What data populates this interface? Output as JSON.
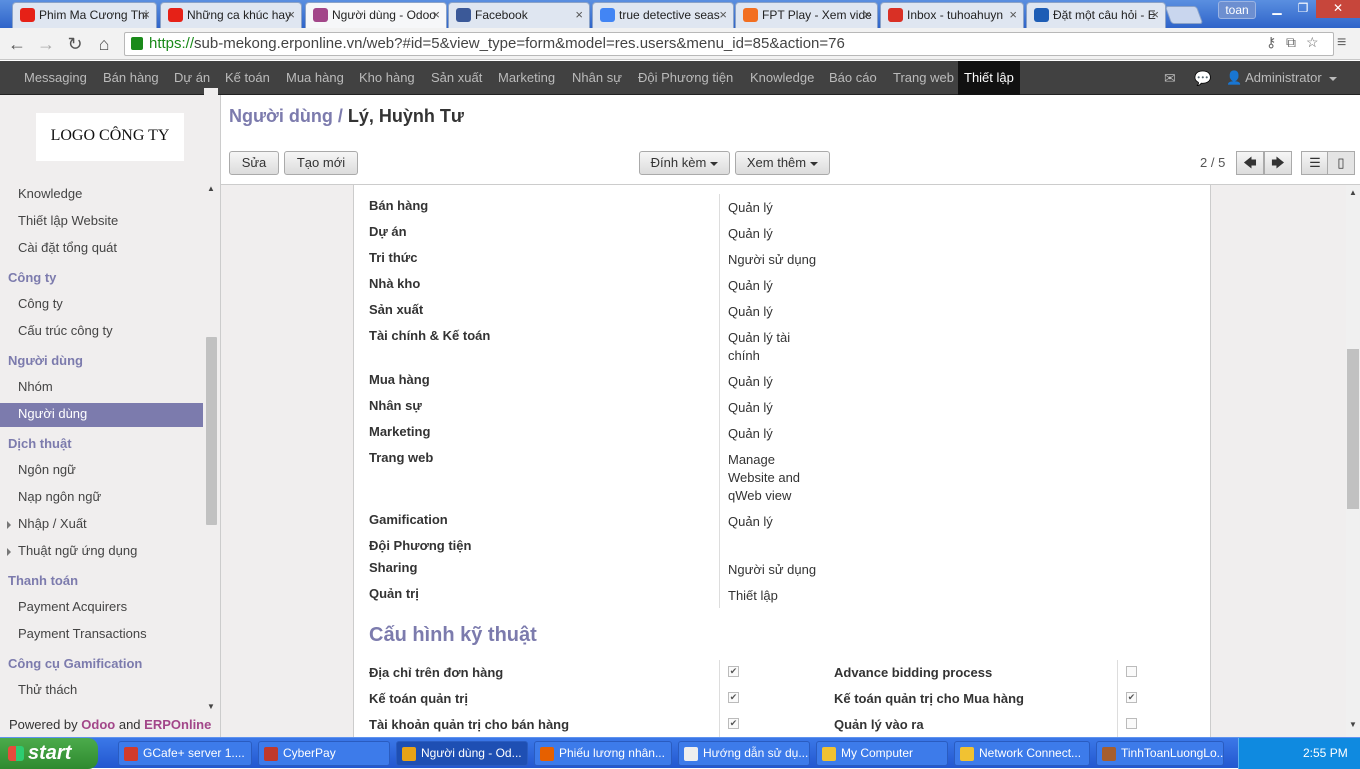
{
  "browser": {
    "tabs": [
      {
        "title": "Phim Ma Cương Thi",
        "icon": "youtube-icon",
        "color": "#e62117"
      },
      {
        "title": "Những ca khúc hay",
        "icon": "youtube-icon",
        "color": "#e62117"
      },
      {
        "title": "Người dùng - Odoo",
        "icon": "odoo-icon",
        "color": "#a24689"
      },
      {
        "title": "Facebook",
        "icon": "facebook-icon",
        "color": "#3b5998"
      },
      {
        "title": "true detective seas",
        "icon": "google-icon",
        "color": "#4285f4"
      },
      {
        "title": "FPT Play - Xem vide",
        "icon": "fptplay-icon",
        "color": "#f26f21"
      },
      {
        "title": "Inbox - tuhoahuyn",
        "icon": "gmail-icon",
        "color": "#d93025"
      },
      {
        "title": "Đặt một câu hỏi - E",
        "icon": "stackexchange-icon",
        "color": "#1e5db5"
      }
    ],
    "profile": "toan",
    "url_scheme": "https://",
    "url_rest": "sub-mekong.erponline.vn/web?#id=5&view_type=form&model=res.users&menu_id=85&action=76"
  },
  "topmenu": {
    "items": [
      "Messaging",
      "Bán hàng",
      "Dự án",
      "Kế toán",
      "Mua hàng",
      "Kho hàng",
      "Sản xuất",
      "Marketing",
      "Nhân sự",
      "Đội Phương tiện",
      "Knowledge",
      "Báo cáo",
      "Trang web",
      "Thiết lập"
    ],
    "active": "Thiết lập",
    "user": "Administrator"
  },
  "sidebar": {
    "logo": "LOGO CÔNG TY",
    "rows": [
      {
        "type": "item",
        "label": "Knowledge"
      },
      {
        "type": "item",
        "label": "Thiết lập Website"
      },
      {
        "type": "item",
        "label": "Cài đặt tổng quát"
      },
      {
        "type": "section",
        "label": "Công ty"
      },
      {
        "type": "item",
        "label": "Công ty"
      },
      {
        "type": "item",
        "label": "Cấu trúc công ty"
      },
      {
        "type": "section",
        "label": "Người dùng"
      },
      {
        "type": "item",
        "label": "Nhóm"
      },
      {
        "type": "item",
        "label": "Người dùng",
        "active": true
      },
      {
        "type": "section",
        "label": "Dịch thuật"
      },
      {
        "type": "item",
        "label": "Ngôn ngữ"
      },
      {
        "type": "item",
        "label": "Nạp ngôn ngữ"
      },
      {
        "type": "item",
        "label": "Nhập / Xuất",
        "arrow": true
      },
      {
        "type": "item",
        "label": "Thuật ngữ ứng dụng",
        "arrow": true
      },
      {
        "type": "section",
        "label": "Thanh toán"
      },
      {
        "type": "item",
        "label": "Payment Acquirers"
      },
      {
        "type": "item",
        "label": "Payment Transactions"
      },
      {
        "type": "section",
        "label": "Công cụ Gamification"
      },
      {
        "type": "item",
        "label": "Thử thách"
      }
    ],
    "powered_prefix": "Powered by",
    "powered_odoo": "Odoo",
    "powered_and": "and",
    "powered_erp": "ERPOnline"
  },
  "header": {
    "crumb_parent": "Người dùng",
    "crumb_sep": "/",
    "crumb_current": "Lý, Huỳnh Tư",
    "edit": "Sửa",
    "create": "Tạo mới",
    "attach": "Đính kèm",
    "more": "Xem thêm",
    "pager": "2 / 5"
  },
  "access_rights": [
    {
      "label": "Bán hàng",
      "value": "Quản lý"
    },
    {
      "label": "Dự án",
      "value": "Quản lý"
    },
    {
      "label": "Tri thức",
      "value": "Người sử dụng"
    },
    {
      "label": "Nhà kho",
      "value": "Quản lý"
    },
    {
      "label": "Sản xuất",
      "value": "Quản lý"
    },
    {
      "label": "Tài chính & Kế toán",
      "value": "Quản lý tài chính"
    },
    {
      "label": "Mua hàng",
      "value": "Quản lý"
    },
    {
      "label": "Nhân sự",
      "value": "Quản lý"
    },
    {
      "label": "Marketing",
      "value": "Quản lý"
    },
    {
      "label": "Trang web",
      "value": "Manage Website and qWeb view"
    },
    {
      "label": "Gamification",
      "value": "Quản lý"
    },
    {
      "label": "Đội Phương tiện",
      "value": ""
    },
    {
      "label": "Sharing",
      "value": "Người sử dụng"
    },
    {
      "label": "Quản trị",
      "value": "Thiết lập"
    }
  ],
  "technical": {
    "title": "Cấu hình kỹ thuật",
    "left": [
      {
        "label": "Địa chỉ trên đơn hàng",
        "checked": true
      },
      {
        "label": "Kế toán quản trị",
        "checked": true
      },
      {
        "label": "Tài khoản quản trị cho bán hàng",
        "checked": true
      }
    ],
    "right": [
      {
        "label": "Advance bidding process",
        "checked": false
      },
      {
        "label": "Kế toán quản trị cho Mua hàng",
        "checked": true
      },
      {
        "label": "Quản lý vào ra",
        "checked": false
      }
    ]
  },
  "taskbar": {
    "start": "start",
    "tasks": [
      "GCafe+ server 1....",
      "CyberPay",
      "Người dùng - Od...",
      "Phiếu lương nhân...",
      "Hướng dẫn sử dụ...",
      "My Computer",
      "Network Connect...",
      "TinhToanLuongLo..."
    ],
    "active": "Người dùng - Od...",
    "clock": "2:55 PM"
  }
}
